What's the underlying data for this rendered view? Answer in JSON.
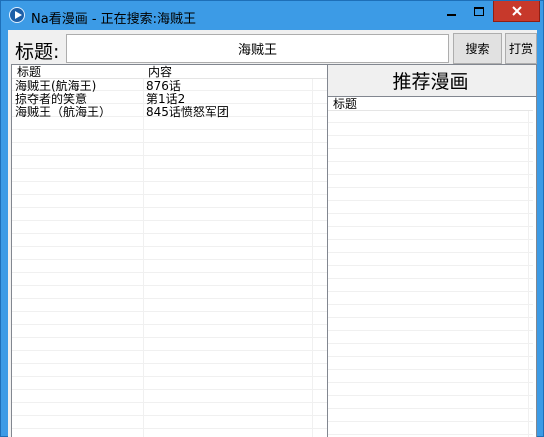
{
  "window": {
    "title": "Na看漫画 - 正在搜索:海贼王"
  },
  "search": {
    "label": "标题:",
    "value": "海贼王",
    "search_button": "搜索",
    "tip_button": "打赏"
  },
  "results": {
    "columns": [
      "标题",
      "内容"
    ],
    "rows": [
      [
        "海贼王(航海王)",
        "876话"
      ],
      [
        "掠夺者的笑意",
        "第1话2"
      ],
      [
        "海贼王（航海王）",
        "845话愤怒军团"
      ]
    ]
  },
  "recommend": {
    "heading": "推荐漫画",
    "columns": [
      "标题"
    ]
  },
  "colors": {
    "titlebar": "#3c9be6",
    "close_button": "#c7392b",
    "window_bg": "#f0f0f0"
  },
  "icons": {
    "app": "play-icon",
    "minimize": "minimize-icon",
    "maximize": "maximize-icon",
    "close": "close-icon"
  }
}
